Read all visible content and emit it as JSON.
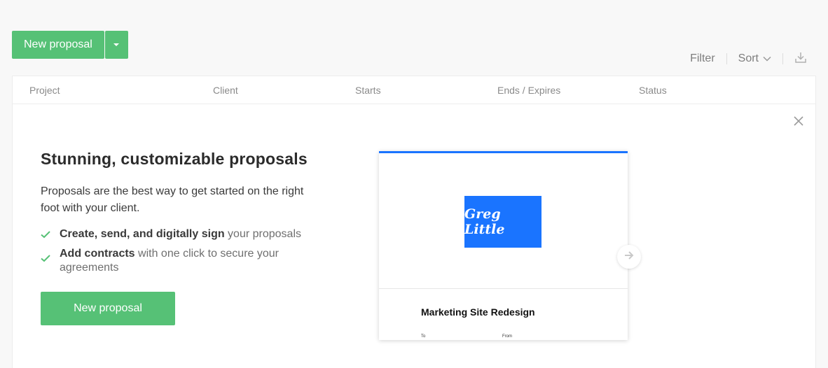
{
  "actions": {
    "new_proposal_label": "New proposal"
  },
  "toolbar": {
    "filter_label": "Filter",
    "sort_label": "Sort"
  },
  "table": {
    "columns": [
      "Project",
      "Client",
      "Starts",
      "Ends / Expires",
      "Status"
    ]
  },
  "promo": {
    "title": "Stunning, customizable proposals",
    "description": "Proposals are the best way to get started on the right foot with your client.",
    "features": [
      {
        "bold": "Create, send, and digitally sign",
        "rest": " your proposals"
      },
      {
        "bold": "Add contracts",
        "rest": " with one click to secure your agreements"
      }
    ],
    "button_label": "New proposal",
    "preview": {
      "logo_text": "Greg Little",
      "doc_title": "Marketing Site Redesign",
      "to_label": "To",
      "from_label": "From"
    }
  },
  "colors": {
    "accent": "#56c176",
    "preview_blue": "#1a74ff",
    "background": "#f8f8f8"
  },
  "icons": [
    "chevron-down-icon",
    "download-icon",
    "close-icon",
    "check-icon",
    "arrow-right-icon"
  ]
}
